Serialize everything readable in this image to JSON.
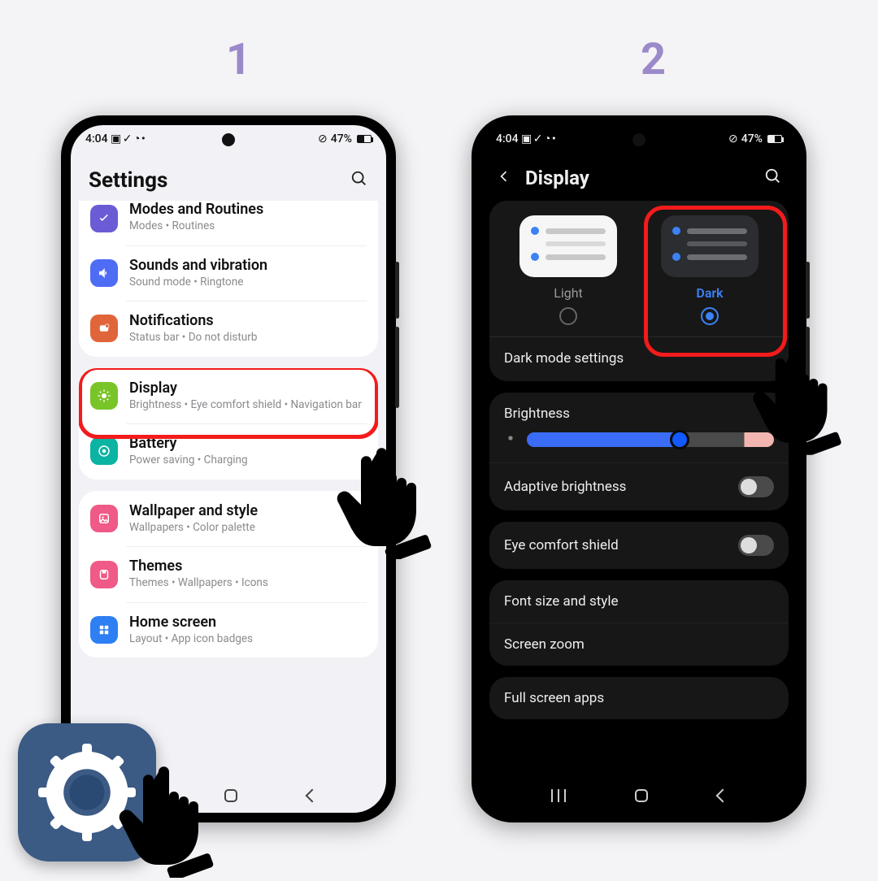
{
  "steps": {
    "one": "1",
    "two": "2"
  },
  "status": {
    "time": "4:04",
    "icons": "▣ ✓ ◔ •",
    "wifi": "⏚",
    "nodata": "⊘",
    "battery": "47%"
  },
  "left": {
    "title": "Settings",
    "rows": [
      {
        "icon": "check",
        "color": "#6b5bd4",
        "title": "Modes and Routines",
        "sub": "Modes  •  Routines"
      },
      {
        "icon": "sound",
        "color": "#4f6cf5",
        "title": "Sounds and vibration",
        "sub": "Sound mode  •  Ringtone"
      },
      {
        "icon": "notif",
        "color": "#e0653a",
        "title": "Notifications",
        "sub": "Status bar  •  Do not disturb"
      }
    ],
    "rows2": [
      {
        "icon": "display",
        "color": "#79c428",
        "title": "Display",
        "sub": "Brightness  •  Eye comfort shield  •  Navigation bar"
      },
      {
        "icon": "battery",
        "color": "#0bb3a3",
        "title": "Battery",
        "sub": "Power saving  •  Charging"
      }
    ],
    "rows3": [
      {
        "icon": "wall",
        "color": "#ef5a86",
        "title": "Wallpaper and style",
        "sub": "Wallpapers  •  Color palette"
      },
      {
        "icon": "theme",
        "color": "#ef5a86",
        "title": "Themes",
        "sub": "Themes  •  Wallpapers  •  Icons"
      },
      {
        "icon": "home",
        "color": "#2e7ff3",
        "title": "Home screen",
        "sub": "Layout  •  App icon badges"
      }
    ]
  },
  "right": {
    "title": "Display",
    "light": "Light",
    "dark": "Dark",
    "dmSettings": "Dark mode settings",
    "brightness": "Brightness",
    "adaptive": "Adaptive brightness",
    "eye": "Eye comfort shield",
    "font": "Font size and style",
    "zoom": "Screen zoom",
    "full": "Full screen apps",
    "brightness_value": 62
  }
}
